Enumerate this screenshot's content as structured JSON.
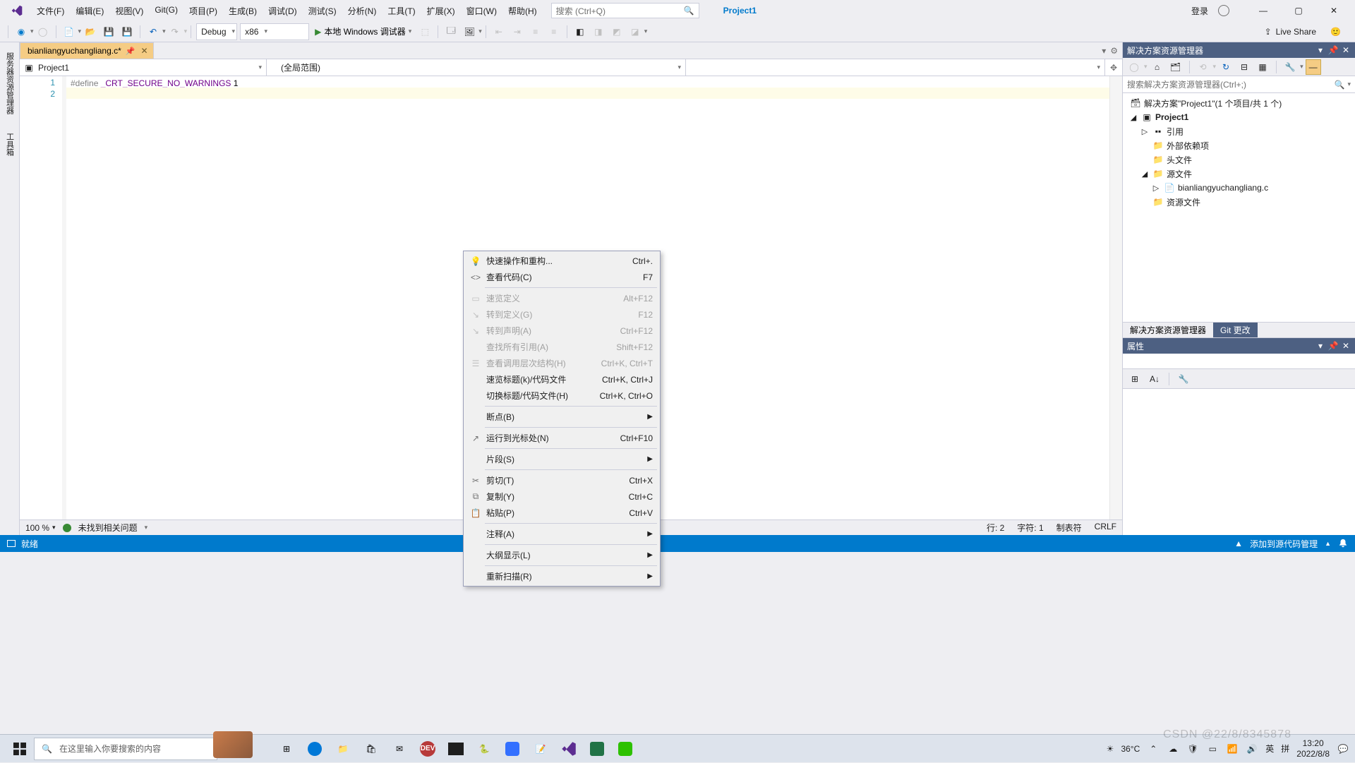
{
  "menubar": {
    "items": [
      "文件(F)",
      "编辑(E)",
      "视图(V)",
      "Git(G)",
      "项目(P)",
      "生成(B)",
      "调试(D)",
      "测试(S)",
      "分析(N)",
      "工具(T)",
      "扩展(X)",
      "窗口(W)",
      "帮助(H)"
    ],
    "search_placeholder": "搜索 (Ctrl+Q)",
    "project_label": "Project1",
    "login_label": "登录"
  },
  "toolbar": {
    "config": "Debug",
    "platform": "x86",
    "run_label": "本地 Windows 调试器",
    "live_share": "Live Share"
  },
  "tabs": {
    "file_tab": "bianliangyuchangliang.c*"
  },
  "nav": {
    "scope1": "Project1",
    "scope2": "(全局范围)",
    "scope3": ""
  },
  "code": {
    "lines": [
      "1",
      "2"
    ],
    "line1_pp": "#define ",
    "line1_macro": "_CRT_SECURE_NO_WARNINGS",
    "line1_tail": " 1"
  },
  "editor_footer": {
    "zoom": "100 %",
    "issues": "未找到相关问题",
    "line": "行: 2",
    "char": "字符: 1",
    "tab": "制表符",
    "eol": "CRLF"
  },
  "solution": {
    "panel_title": "解决方案资源管理器",
    "search_placeholder": "搜索解决方案资源管理器(Ctrl+;)",
    "root": "解决方案\"Project1\"(1 个项目/共 1 个)",
    "project": "Project1",
    "refs": "引用",
    "ext_deps": "外部依赖项",
    "headers": "头文件",
    "sources": "源文件",
    "source_file": "bianliangyuchangliang.c",
    "resources": "资源文件",
    "bottom_tabs": [
      "解决方案资源管理器",
      "Git 更改"
    ]
  },
  "properties": {
    "title": "属性"
  },
  "context_menu": [
    {
      "icon": "💡",
      "label": "快速操作和重构...",
      "shortcut": "Ctrl+.",
      "enabled": true
    },
    {
      "icon": "<>",
      "label": "查看代码(C)",
      "shortcut": "F7",
      "enabled": true
    },
    {
      "sep": true
    },
    {
      "icon": "▭",
      "label": "速览定义",
      "shortcut": "Alt+F12",
      "enabled": false
    },
    {
      "icon": "↘",
      "label": "转到定义(G)",
      "shortcut": "F12",
      "enabled": false
    },
    {
      "icon": "↘",
      "label": "转到声明(A)",
      "shortcut": "Ctrl+F12",
      "enabled": false
    },
    {
      "icon": "",
      "label": "查找所有引用(A)",
      "shortcut": "Shift+F12",
      "enabled": false
    },
    {
      "icon": "☰",
      "label": "查看调用层次结构(H)",
      "shortcut": "Ctrl+K, Ctrl+T",
      "enabled": false
    },
    {
      "icon": "",
      "label": "速览标题(k)/代码文件",
      "shortcut": "Ctrl+K, Ctrl+J",
      "enabled": true
    },
    {
      "icon": "",
      "label": "切换标题/代码文件(H)",
      "shortcut": "Ctrl+K, Ctrl+O",
      "enabled": true
    },
    {
      "sep": true
    },
    {
      "icon": "",
      "label": "断点(B)",
      "shortcut": "",
      "enabled": true,
      "sub": true
    },
    {
      "sep": true
    },
    {
      "icon": "↗",
      "label": "运行到光标处(N)",
      "shortcut": "Ctrl+F10",
      "enabled": true
    },
    {
      "sep": true
    },
    {
      "icon": "",
      "label": "片段(S)",
      "shortcut": "",
      "enabled": true,
      "sub": true
    },
    {
      "sep": true
    },
    {
      "icon": "✂",
      "label": "剪切(T)",
      "shortcut": "Ctrl+X",
      "enabled": true
    },
    {
      "icon": "⧉",
      "label": "复制(Y)",
      "shortcut": "Ctrl+C",
      "enabled": true
    },
    {
      "icon": "📋",
      "label": "粘贴(P)",
      "shortcut": "Ctrl+V",
      "enabled": true
    },
    {
      "sep": true
    },
    {
      "icon": "",
      "label": "注释(A)",
      "shortcut": "",
      "enabled": true,
      "sub": true
    },
    {
      "sep": true
    },
    {
      "icon": "",
      "label": "大纲显示(L)",
      "shortcut": "",
      "enabled": true,
      "sub": true
    },
    {
      "sep": true
    },
    {
      "icon": "",
      "label": "重新扫描(R)",
      "shortcut": "",
      "enabled": true,
      "sub": true
    }
  ],
  "statusbar": {
    "ready": "就绪",
    "add_src": "添加到源代码管理",
    "up_arrow": "▲"
  },
  "taskbar": {
    "search_placeholder": "在这里输入你要搜索的内容",
    "weather_temp": "36°C",
    "ime_lang": "英",
    "ime_sub": "拼",
    "time": "13:20",
    "date": "2022/8/8",
    "watermark": "CSDN @22/8/8345878"
  }
}
